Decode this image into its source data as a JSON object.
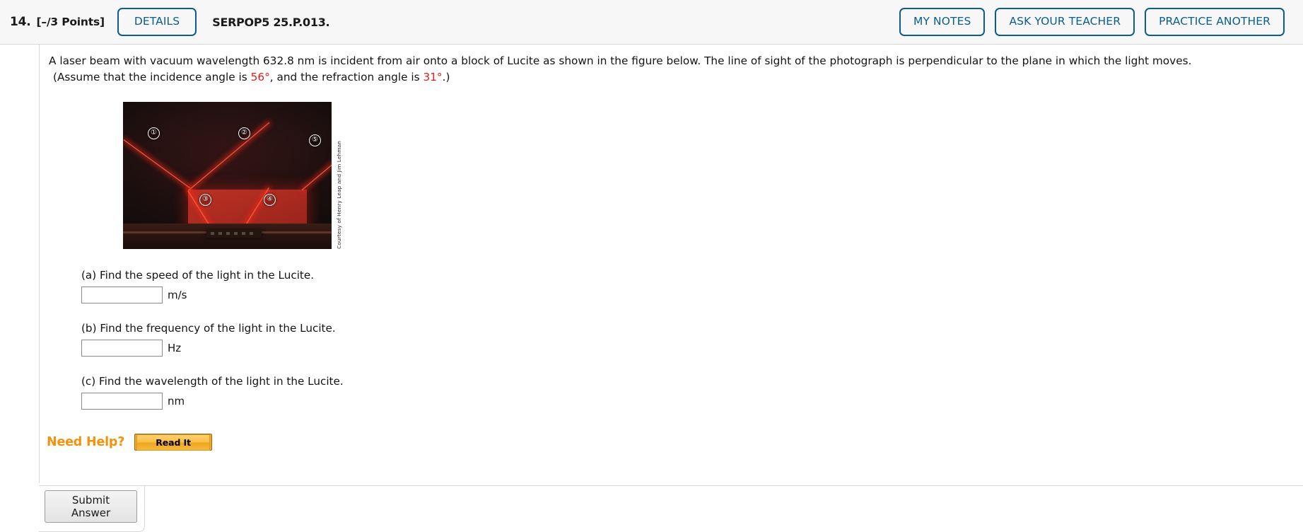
{
  "header": {
    "question_number": "14.",
    "points": "[–/3 Points]",
    "details_label": "DETAILS",
    "question_code": "SERPOP5 25.P.013.",
    "actions": [
      {
        "label": "MY NOTES",
        "name": "my-notes-button"
      },
      {
        "label": "ASK YOUR TEACHER",
        "name": "ask-your-teacher-button"
      },
      {
        "label": "PRACTICE ANOTHER",
        "name": "practice-another-button"
      }
    ]
  },
  "question": {
    "stem_line1": "A laser beam with vacuum wavelength 632.8 nm is incident from air onto a block of Lucite as shown in the figure below. The line of sight of the photograph is perpendicular to the plane in which the light moves.",
    "stem_line2_pre": "(Assume that the incidence angle is ",
    "incidence_angle": "56°",
    "stem_line2_mid": ", and the refraction angle is ",
    "refraction_angle": "31°",
    "stem_line2_post": ".)"
  },
  "figure": {
    "credit": "Courtesy of Henry Leap and Jim Lehman",
    "markers": [
      "①",
      "②",
      "③",
      "④",
      "⑤"
    ]
  },
  "parts": [
    {
      "label": "(a) Find the speed of the light in the Lucite.",
      "value": "",
      "placeholder": "",
      "unit": "m/s",
      "input_name": "answer-input-a"
    },
    {
      "label": "(b) Find the frequency of the light in the Lucite.",
      "value": "",
      "placeholder": "",
      "unit": "Hz",
      "input_name": "answer-input-b"
    },
    {
      "label": "(c) Find the wavelength of the light in the Lucite.",
      "value": "",
      "placeholder": "",
      "unit": "nm",
      "input_name": "answer-input-c"
    }
  ],
  "help": {
    "need_help_label": "Need Help?",
    "read_it_label": "Read It"
  },
  "footer": {
    "submit_label": "Submit Answer"
  },
  "colors": {
    "accent_blue": "#0b5c8f",
    "red_value": "#e01b1b",
    "orange": "#f2930d",
    "header_bg": "#f7f7f7"
  }
}
